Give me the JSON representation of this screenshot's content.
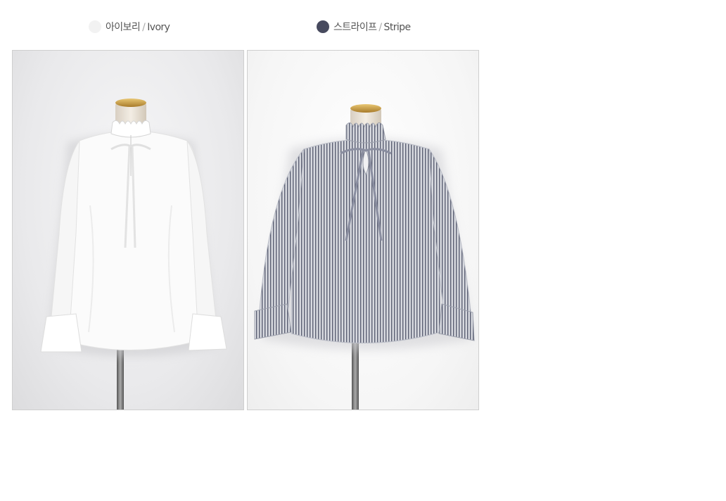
{
  "colors": [
    {
      "name_ko": "아이보리",
      "separator": "/",
      "name_en": "Ivory",
      "swatch_color": "#f2f2f2"
    },
    {
      "name_ko": "스트라이프",
      "separator": "/",
      "name_en": "Stripe",
      "swatch_color": "#474a5e"
    }
  ],
  "photos": [
    {
      "subject": "ivory-ruffle-neck-blouse-on-mannequin"
    },
    {
      "subject": "stripe-ruffle-neck-blouse-on-mannequin"
    }
  ]
}
